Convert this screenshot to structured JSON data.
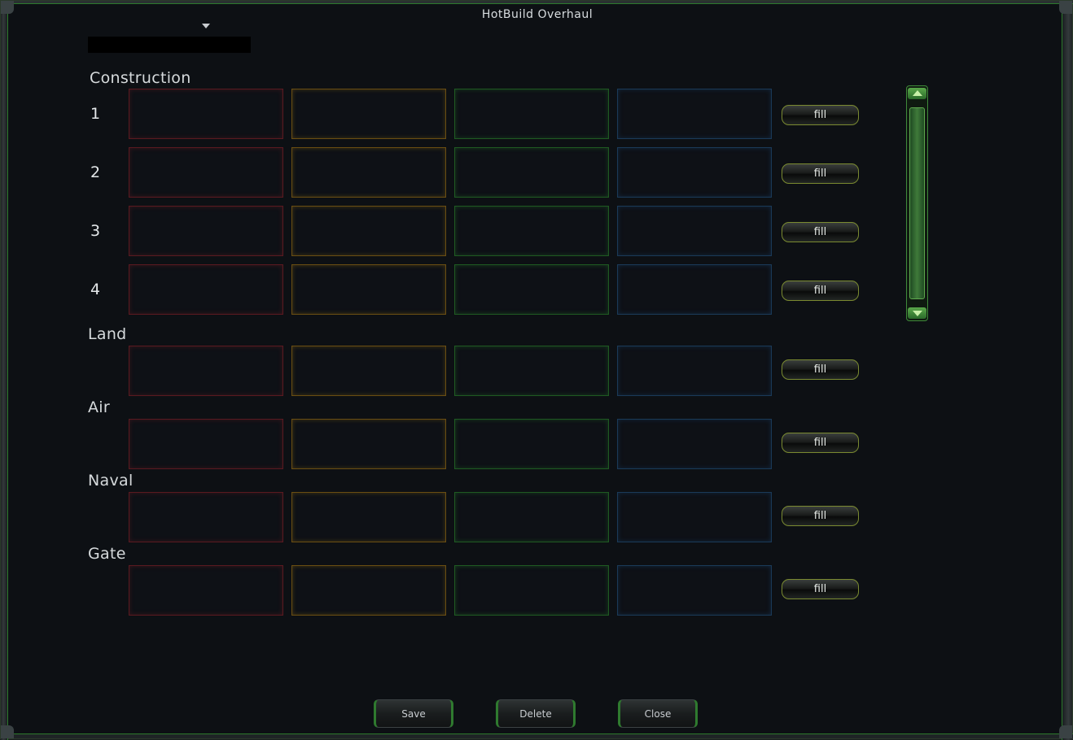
{
  "window": {
    "title": "HotBuild Overhaul"
  },
  "name_field": {
    "value": ""
  },
  "sections": {
    "construction": "Construction",
    "land": "Land",
    "air": "Air",
    "naval": "Naval",
    "gate": "Gate"
  },
  "row_numbers": [
    "1",
    "2",
    "3",
    "4"
  ],
  "fill_label": "fill",
  "buttons": {
    "save": "Save",
    "delete": "Delete",
    "close": "Close"
  },
  "slot_colors": {
    "red": "#5a1a20",
    "yellow": "#6a4e12",
    "green": "#1f5a22",
    "blue": "#1a3a58"
  },
  "icons": {
    "dropdown": "chevron-down-icon",
    "scroll_up": "arrow-up-icon",
    "scroll_down": "arrow-down-icon"
  }
}
